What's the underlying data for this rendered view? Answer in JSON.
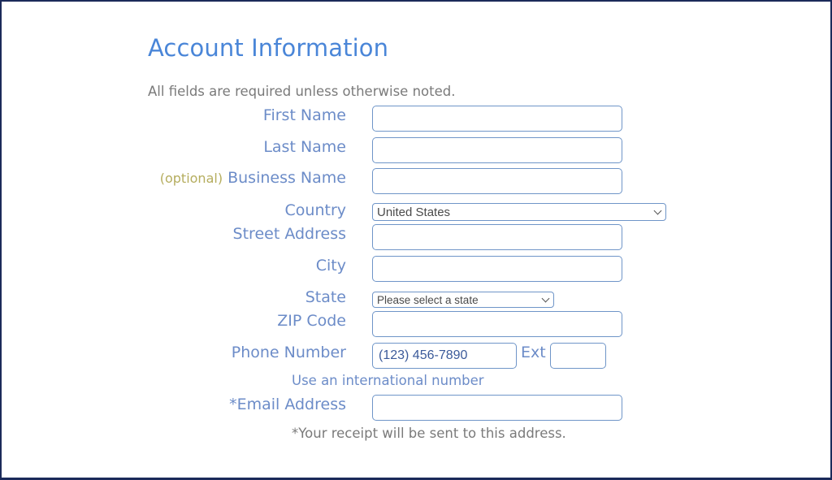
{
  "page": {
    "title": "Account Information",
    "subtitle": "All fields are required unless otherwise noted."
  },
  "colors": {
    "title": "#4a86d8",
    "label": "#6c8cc8",
    "optional": "#b5ad5e",
    "input_border": "#6f95c8",
    "frame": "#1b2a5a"
  },
  "form": {
    "first_name": {
      "label": "First Name",
      "value": ""
    },
    "last_name": {
      "label": "Last Name",
      "value": ""
    },
    "business_name": {
      "optional_tag": "(optional)",
      "label": "Business Name",
      "value": ""
    },
    "country": {
      "label": "Country",
      "selected": "United States"
    },
    "street_address": {
      "label": "Street Address",
      "value": ""
    },
    "city": {
      "label": "City",
      "value": ""
    },
    "state": {
      "label": "State",
      "selected": "Please select a state"
    },
    "zip": {
      "label": "ZIP Code",
      "value": ""
    },
    "phone": {
      "label": "Phone Number",
      "placeholder": "(123) 456-7890",
      "ext_label": "Ext",
      "ext_value": "",
      "international_link": "Use an international number"
    },
    "email": {
      "label": "*Email Address",
      "value": "",
      "note": "*Your receipt will be sent to this address."
    }
  }
}
